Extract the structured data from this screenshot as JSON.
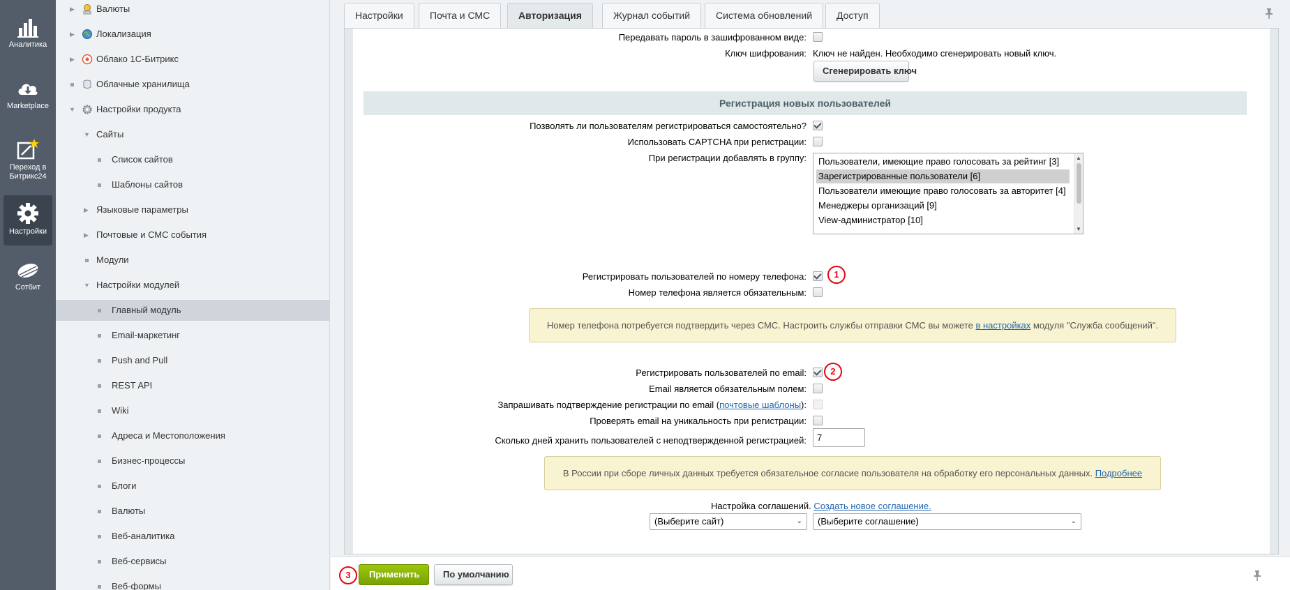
{
  "left_nav": {
    "items": [
      {
        "label": "Аналитика",
        "icon": "analytics-icon"
      },
      {
        "label": "Marketplace",
        "icon": "cloud-download-icon"
      },
      {
        "label": "Переход в Битрикс24",
        "icon": "bitrix24-icon"
      },
      {
        "label": "Настройки",
        "icon": "gear-icon"
      },
      {
        "label": "Сотбит",
        "icon": "sotbit-icon"
      }
    ]
  },
  "tree": {
    "items": [
      {
        "label": "Валюты"
      },
      {
        "label": "Локализация"
      },
      {
        "label": "Облако 1С-Битрикс"
      },
      {
        "label": "Облачные хранилища"
      },
      {
        "label": "Настройки продукта"
      },
      {
        "label": "Сайты"
      },
      {
        "label": "Список сайтов"
      },
      {
        "label": "Шаблоны сайтов"
      },
      {
        "label": "Языковые параметры"
      },
      {
        "label": "Почтовые и СМС события"
      },
      {
        "label": "Модули"
      },
      {
        "label": "Настройки модулей"
      },
      {
        "label": "Главный модуль"
      },
      {
        "label": "Email-маркетинг"
      },
      {
        "label": "Push and Pull"
      },
      {
        "label": "REST API"
      },
      {
        "label": "Wiki"
      },
      {
        "label": "Адреса и Местоположения"
      },
      {
        "label": "Бизнес-процессы"
      },
      {
        "label": "Блоги"
      },
      {
        "label": "Валюты"
      },
      {
        "label": "Веб-аналитика"
      },
      {
        "label": "Веб-сервисы"
      },
      {
        "label": "Веб-формы"
      }
    ]
  },
  "tabs": [
    "Настройки",
    "Почта и СМС",
    "Авторизация",
    "Журнал событий",
    "Система обновлений",
    "Доступ"
  ],
  "form": {
    "encrypt_password_label": "Передавать пароль в зашифрованном виде:",
    "encryption_key_label": "Ключ шифрования:",
    "encryption_key_value": "Ключ не найден. Необходимо сгенерировать новый ключ.",
    "generate_key_button": "Сгенерировать ключ",
    "section_title": "Регистрация новых пользователей",
    "allow_self_register_label": "Позволять ли пользователям регистрироваться самостоятельно?",
    "use_captcha_label": "Использовать CAPTCHA при регистрации:",
    "add_to_group_label": "При регистрации добавлять в группу:",
    "groups": [
      "Пользователи, имеющие право голосовать за рейтинг [3]",
      "Зарегистрированные пользователи [6]",
      "Пользователи имеющие право голосовать за авторитет [4]",
      "Менеджеры организаций [9]",
      "View-администратор [10]"
    ],
    "register_by_phone_label": "Регистрировать пользователей по номеру телефона:",
    "phone_required_label": "Номер телефона является обязательным:",
    "phone_note_before": "Номер телефона потребуется подтвердить через СМС. Настроить службы отправки СМС вы можете ",
    "phone_note_link": "в настройках",
    "phone_note_after": " модуля \"Служба сообщений\".",
    "register_by_email_label": "Регистрировать пользователей по email:",
    "email_required_label": "Email является обязательным полем:",
    "email_confirm_before": "Запрашивать подтверждение регистрации по email (",
    "email_confirm_link": "почтовые шаблоны",
    "email_confirm_after": "):",
    "email_unique_label": "Проверять email на уникальность при регистрации:",
    "keep_days_label": "Сколько дней хранить пользователей с неподтвержденной регистрацией:",
    "keep_days_value": "7",
    "consent_note": "В России при сборе личных данных требуется обязательное согласие пользователя на обработку его персональных данных. ",
    "consent_note_link": "Подробнее",
    "agreement_label": "Настройка соглашений.",
    "agreement_link": "Создать новое соглашение.",
    "site_select": "(Выберите сайт)",
    "agreement_select": "(Выберите соглашение)"
  },
  "markers": [
    "1",
    "2",
    "3"
  ],
  "footer": {
    "apply_button": "Применить",
    "default_button": "По умолчанию"
  },
  "colors": {
    "nav_bg": "#535c69",
    "apply_green": "#86b300",
    "marker_red": "#e30613",
    "link_blue": "#2067b0"
  }
}
